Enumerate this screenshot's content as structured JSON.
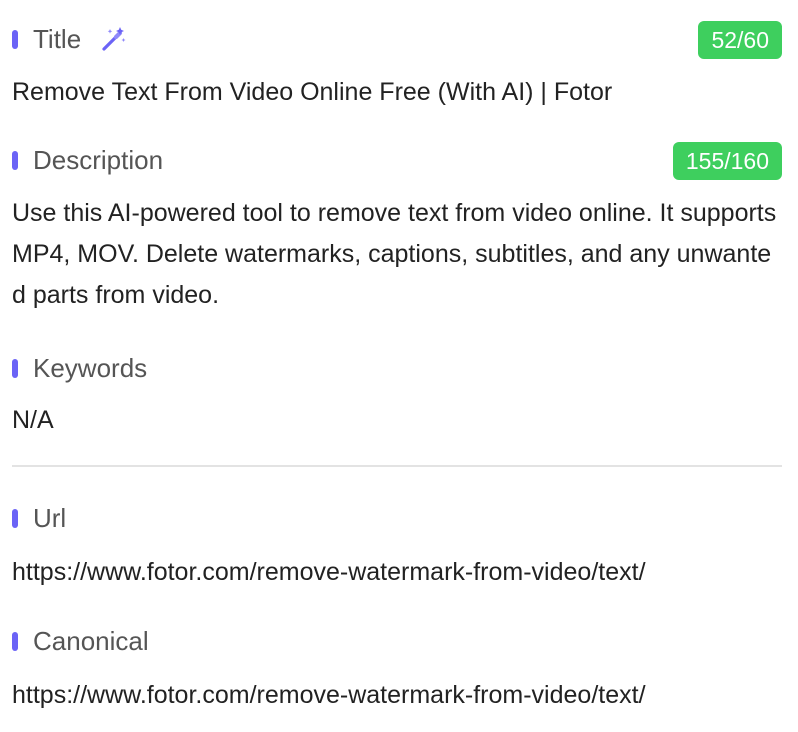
{
  "title": {
    "label": "Title",
    "icon": "magic-wand-icon",
    "count": "52/60",
    "value": "Remove Text From Video Online Free (With AI) | Fotor"
  },
  "description": {
    "label": "Description",
    "count": "155/160",
    "value": "Use this AI-powered tool to remove text from video online. It supports MP4, MOV. Delete watermarks, captions, subtitles, and any unwanted parts from video."
  },
  "keywords": {
    "label": "Keywords",
    "value": "N/A"
  },
  "url": {
    "label": "Url",
    "value": "https://www.fotor.com/remove-watermark-from-video/text/"
  },
  "canonical": {
    "label": "Canonical",
    "value": "https://www.fotor.com/remove-watermark-from-video/text/"
  },
  "colors": {
    "accent": "#6b63f6",
    "badge_green": "#3ecf5e",
    "label_gray": "#555555",
    "text": "#222222",
    "divider": "#e3e3e3"
  }
}
